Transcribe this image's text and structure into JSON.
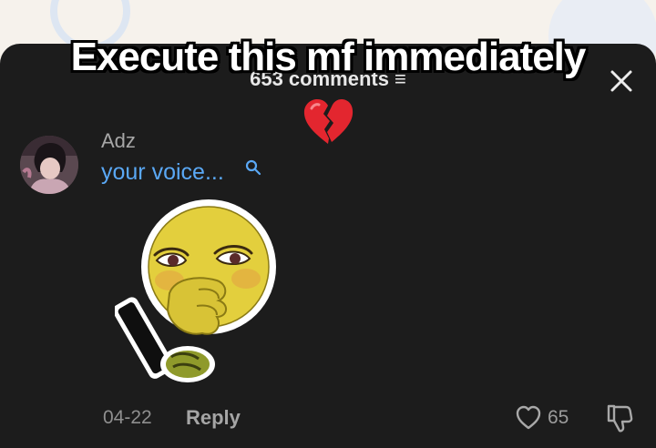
{
  "overlay": {
    "caption": "Execute this mf immediately"
  },
  "header": {
    "comments_count": "653 comments ≡",
    "close_icon": "close-icon"
  },
  "reaction_emoji": "broken-heart-icon",
  "comment": {
    "username": "Adz",
    "text": "your voice...",
    "search_icon": "search-icon",
    "sticker": "sticker-icon",
    "date": "04-22",
    "reply_label": "Reply",
    "like_icon": "heart-outline-icon",
    "like_count": "65",
    "dislike_icon": "thumbs-down-icon"
  },
  "colors": {
    "panel": "#1c1c1c",
    "link": "#5aa8f5",
    "muted": "#8f8f8f",
    "username": "#a7a7a7"
  }
}
